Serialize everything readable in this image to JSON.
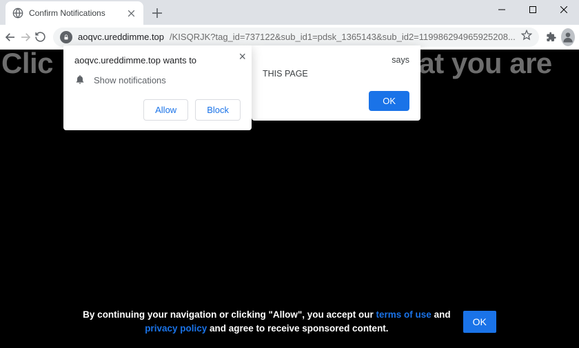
{
  "tab": {
    "title": "Confirm Notifications"
  },
  "omnibox": {
    "host": "aoqvc.ureddimme.top",
    "path": "/KISQRJK?tag_id=737122&sub_id1=pdsk_1365143&sub_id2=119986294965925208..."
  },
  "page": {
    "headline_left": "Clic",
    "headline_right": "at you are"
  },
  "perm": {
    "origin": "aoqvc.ureddimme.top wants to",
    "notif": "Show notifications",
    "allow": "Allow",
    "block": "Block"
  },
  "alert": {
    "says": "says",
    "message": "THIS PAGE",
    "ok": "OK"
  },
  "footer": {
    "pre": "By continuing your navigation or clicking \"Allow\", you accept our ",
    "tou": "terms of use",
    "mid": " and ",
    "pp": "privacy policy",
    "post": " and agree to receive sponsored content.",
    "ok": "OK"
  }
}
